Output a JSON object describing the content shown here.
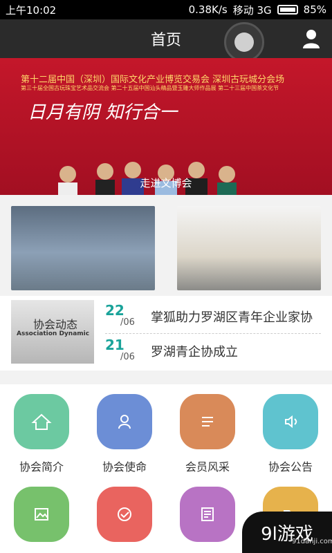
{
  "status_bar": {
    "time": "上午10:02",
    "speed": "0.38K/s",
    "carrier": "移动 3G",
    "battery": "85%"
  },
  "header": {
    "title": "首页"
  },
  "banner": {
    "title": "第十二届中国（深圳）国际文化产业博览交易会 深圳古玩城分会场",
    "subtitle": "第三十届全国古玩珠宝艺术品交流会 第二十五届中国汕头精品暨玉雕大师作品展 第二十三届中国茶文化节",
    "slogan": "日月有阴 知行合一",
    "caption": "走进文博会"
  },
  "news": {
    "thumb_title": "协会动态",
    "thumb_subtitle": "Association Dynamic",
    "items": [
      {
        "day": "22",
        "month": "/06",
        "text": "掌狐助力罗湖区青年企业家协"
      },
      {
        "day": "21",
        "month": "/06",
        "text": "罗湖青企协成立"
      }
    ]
  },
  "grid": {
    "items": [
      {
        "label": "协会简介",
        "color": "#6cc9a1",
        "icon": "home-icon"
      },
      {
        "label": "协会使命",
        "color": "#6c8ed6",
        "icon": "user-icon"
      },
      {
        "label": "会员风采",
        "color": "#d98a59",
        "icon": "list-icon"
      },
      {
        "label": "协会公告",
        "color": "#5fc3cf",
        "icon": "speaker-icon"
      },
      {
        "label": "",
        "color": "#77c16c",
        "icon": "image-icon"
      },
      {
        "label": "",
        "color": "#e9645f",
        "icon": "check-icon"
      },
      {
        "label": "",
        "color": "#b873c4",
        "icon": "document-icon"
      },
      {
        "label": "",
        "color": "#e6b24c",
        "icon": "folder-icon"
      }
    ]
  },
  "watermark": {
    "brand": "9l游戏",
    "site": "91danji.com"
  }
}
